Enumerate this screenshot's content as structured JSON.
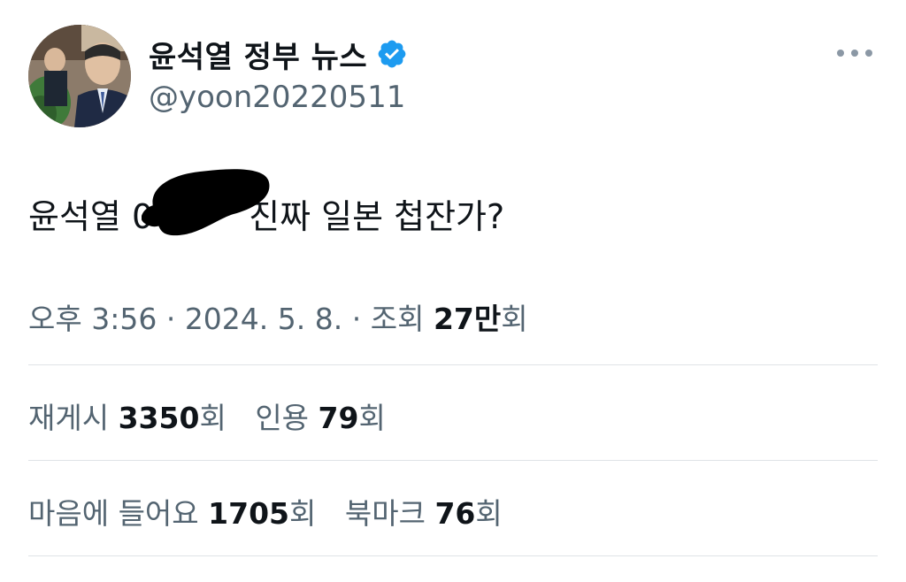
{
  "profile": {
    "display_name": "윤석열 정부 뉴스",
    "handle": "@yoon20220511",
    "verified_icon": "verified-badge-icon",
    "accent": "#1d9bf0"
  },
  "tweet": {
    "text_before": "윤석열 0",
    "text_after": "진짜 일본 첩잔가?"
  },
  "meta": {
    "time": "오후 3:56",
    "sep1": " · ",
    "date": "2024. 5. 8.",
    "sep2": " · ",
    "views_label": "조회 ",
    "views_value": "27만",
    "views_suffix": "회"
  },
  "stats": {
    "reposts_label": "재게시 ",
    "reposts_value": "3350",
    "reposts_suffix": "회",
    "quotes_label": "인용 ",
    "quotes_value": "79",
    "quotes_suffix": "회",
    "likes_label": "마음에 들어요 ",
    "likes_value": "1705",
    "likes_suffix": "회",
    "bookmarks_label": "북마크 ",
    "bookmarks_value": "76",
    "bookmarks_suffix": "회"
  },
  "icons": {
    "more": "more-horizontal-icon"
  }
}
